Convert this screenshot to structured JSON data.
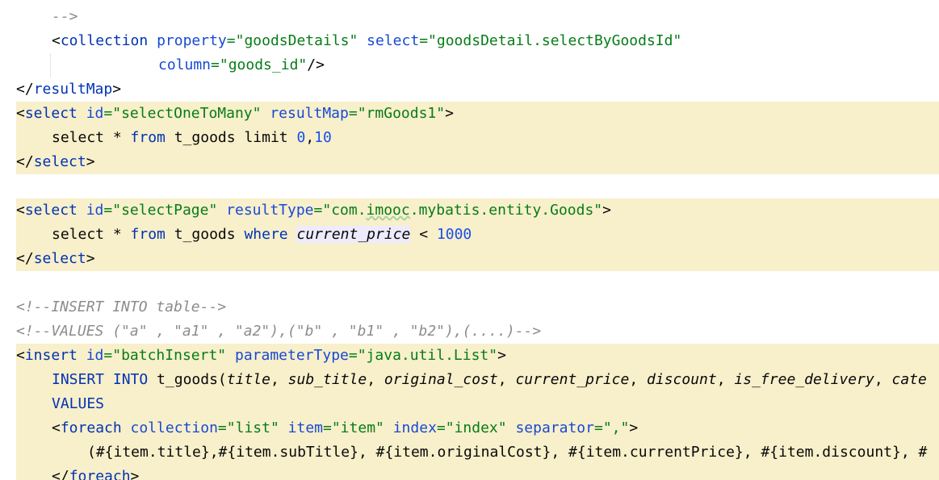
{
  "editor": {
    "line_1": {
      "comment_end": "-->"
    },
    "line_2": {
      "open": "<",
      "tag": "collection",
      "attr1": "property",
      "eq1": "=",
      "val1": "\"goodsDetails\"",
      "attr2": "select",
      "eq2": "=",
      "val2": "\"goodsDetail.selectByGoodsId\""
    },
    "line_3": {
      "attr": "column",
      "eq": "=",
      "val": "\"goods_id\"",
      "close": "/>"
    },
    "line_4": {
      "open": "</",
      "tag": "resultMap",
      "close": ">"
    },
    "line_5": {
      "open": "<",
      "tag": "select",
      "attr1": "id",
      "eq1": "=",
      "val1": "\"selectOneToMany\"",
      "attr2": "resultMap",
      "eq2": "=",
      "val2": "\"rmGoods1\"",
      "close": ">"
    },
    "line_6": {
      "kw_select": "select",
      "star": " * ",
      "kw_from": "from",
      "table": " t_goods ",
      "kw_limit": "limit",
      "num1": "0",
      "comma": ",",
      "num2": "10"
    },
    "line_7": {
      "open": "</",
      "tag": "select",
      "close": ">"
    },
    "line_9": {
      "open": "<",
      "tag": "select",
      "attr1": "id",
      "eq1": "=",
      "val1": "\"selectPage\"",
      "attr2": "resultType",
      "eq2": "=",
      "val2_a": "\"com.",
      "val2_b": "imooc",
      "val2_c": ".mybatis.entity.Goods\"",
      "close": ">"
    },
    "line_10": {
      "kw_select": "select",
      "star": " * ",
      "kw_from": "from",
      "table": " t_goods ",
      "kw_where": "where",
      "column": "current_price",
      "op": " < ",
      "num": "1000"
    },
    "line_11": {
      "open": "</",
      "tag": "select",
      "close": ">"
    },
    "line_13": {
      "comment": "<!--INSERT INTO table-->"
    },
    "line_14": {
      "comment": "<!--VALUES (\"a\" , \"a1\" , \"a2\"),(\"b\" , \"b1\" , \"b2\"),(....)-->"
    },
    "line_15": {
      "open": "<",
      "tag": "insert",
      "attr1": "id",
      "eq1": "=",
      "val1": "\"batchInsert\"",
      "attr2": "parameterType",
      "eq2": "=",
      "val2": "\"java.util.List\"",
      "close": ">"
    },
    "line_16": {
      "kw": "INSERT INTO",
      "table": " t_goods(",
      "col1": "title",
      "sep1": ", ",
      "col2": "sub_title",
      "sep2": ", ",
      "col3": "original_cost",
      "sep3": ", ",
      "col4": "current_price",
      "sep4": ", ",
      "col5": "discount",
      "sep5": ", ",
      "col6": "is_free_delivery",
      "sep6": ", ",
      "col7": "cate"
    },
    "line_17": {
      "kw": "VALUES"
    },
    "line_18": {
      "open": "<",
      "tag": "foreach",
      "attr1": "collection",
      "eq1": "=",
      "val1": "\"list\"",
      "attr2": "item",
      "eq2": "=",
      "val2": "\"item\"",
      "attr3": "index",
      "eq3": "=",
      "val3": "\"index\"",
      "attr4": "separator",
      "eq4": "=",
      "val4": "\",\"",
      "close": ">"
    },
    "line_19": {
      "text": "(#{item.title},#{item.subTitle}, #{item.originalCost}, #{item.currentPrice}, #{item.discount}, #"
    },
    "line_20": {
      "open": "</",
      "tag": "foreach",
      "close": ">"
    }
  },
  "icons": {
    "gutter_marker": "intention-bulb-icon"
  },
  "colors": {
    "highlight_bg": "#f8efcb",
    "tag": "#0033b3",
    "attribute": "#174ad4",
    "string": "#067d17",
    "comment": "#8c8c8c",
    "number": "#1750eb"
  }
}
